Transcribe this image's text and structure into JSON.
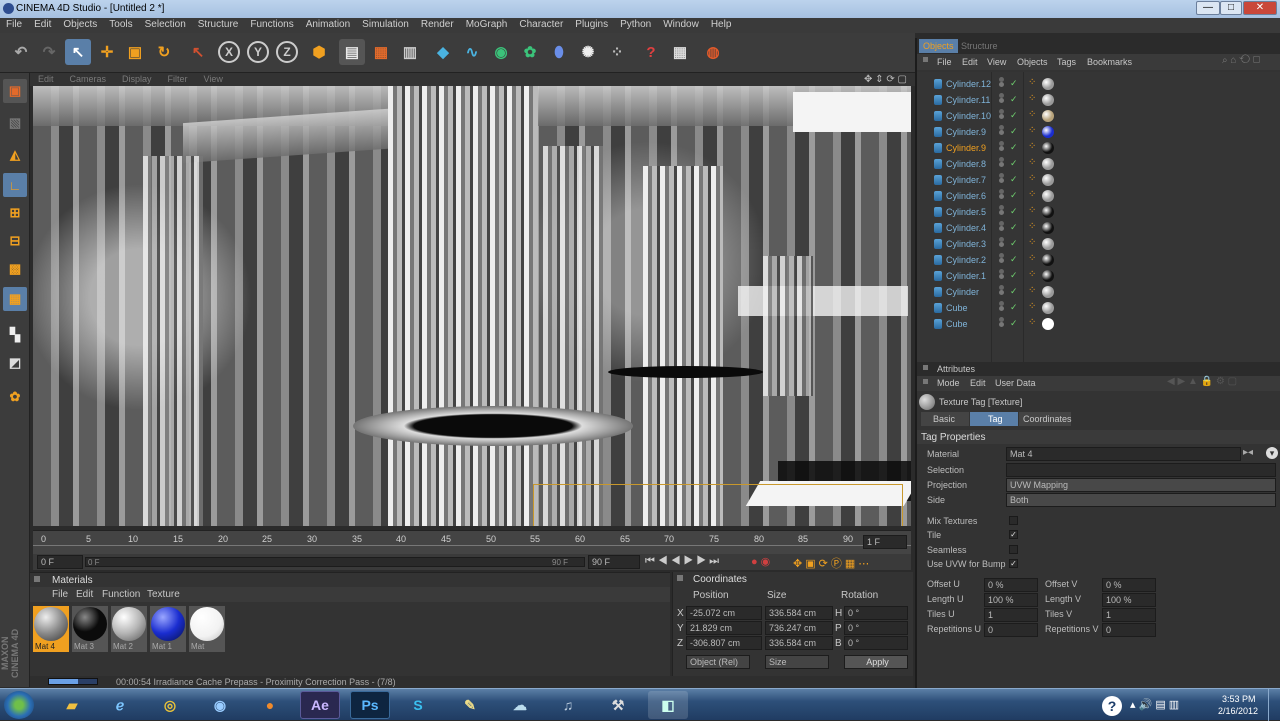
{
  "window": {
    "title": "CINEMA 4D Studio - [Untitled 2 *]",
    "min": "—",
    "max": "□",
    "close": "✕"
  },
  "menu": [
    "File",
    "Edit",
    "Objects",
    "Tools",
    "Selection",
    "Structure",
    "Functions",
    "Animation",
    "Simulation",
    "Render",
    "MoGraph",
    "Character",
    "Plugins",
    "Python",
    "Window",
    "Help"
  ],
  "viewport_menu": [
    "Edit",
    "Cameras",
    "Display",
    "Filter",
    "View"
  ],
  "timeline": {
    "ticks": [
      "0",
      "5",
      "10",
      "15",
      "20",
      "25",
      "30",
      "35",
      "40",
      "45",
      "50",
      "55",
      "60",
      "65",
      "70",
      "75",
      "80",
      "85",
      "90"
    ],
    "end_label": "1 F",
    "start_field": "0 F",
    "current_field": "0 F",
    "max_field": "90 F",
    "end_field": "90 F"
  },
  "materials": {
    "title": "Materials",
    "menu": [
      "File",
      "Edit",
      "Function",
      "Texture"
    ],
    "items": [
      {
        "name": "Mat 4",
        "color": "#8a8a8a"
      },
      {
        "name": "Mat 3",
        "color": "#0b0b0b"
      },
      {
        "name": "Mat 2",
        "color": "#b5b5b5"
      },
      {
        "name": "Mat 1",
        "color": "#1a2dd0"
      },
      {
        "name": "Mat",
        "color": "#ffffff"
      }
    ]
  },
  "coordinates": {
    "title": "Coordinates",
    "headers": [
      "Position",
      "Size",
      "Rotation"
    ],
    "rows": [
      {
        "axis": "X",
        "pos": "-25.072 cm",
        "size": "336.584 cm",
        "rot_axis": "H",
        "rot": "0 °"
      },
      {
        "axis": "Y",
        "pos": "21.829 cm",
        "size": "736.247 cm",
        "rot_axis": "P",
        "rot": "0 °"
      },
      {
        "axis": "Z",
        "pos": "-306.807 cm",
        "size": "336.584 cm",
        "rot_axis": "B",
        "rot": "0 °"
      }
    ],
    "mode": "Object (Rel)",
    "size_mode": "Size",
    "apply": "Apply"
  },
  "status": "00:00:54 Irradiance Cache Prepass - Proximity Correction Pass - (7/8)",
  "branding": "MAXON CINEMA 4D",
  "objects_panel": {
    "tabs": [
      "Objects",
      "Structure"
    ],
    "menu": [
      "File",
      "Edit",
      "View",
      "Objects",
      "Tags",
      "Bookmarks"
    ],
    "rows": [
      {
        "name": "Cylinder.12",
        "mat": "#9a9a9a"
      },
      {
        "name": "Cylinder.11",
        "mat": "#9a9a9a"
      },
      {
        "name": "Cylinder.10",
        "mat": "#b7a27a"
      },
      {
        "name": "Cylinder.9",
        "mat": "#1a2dd0"
      },
      {
        "name": "Cylinder.9",
        "mat": "#111111"
      },
      {
        "name": "Cylinder.8",
        "mat": "#9a9a9a"
      },
      {
        "name": "Cylinder.7",
        "mat": "#9a9a9a"
      },
      {
        "name": "Cylinder.6",
        "mat": "#9a9a9a"
      },
      {
        "name": "Cylinder.5",
        "mat": "#111111"
      },
      {
        "name": "Cylinder.4",
        "mat": "#111111"
      },
      {
        "name": "Cylinder.3",
        "mat": "#9a9a9a"
      },
      {
        "name": "Cylinder.2",
        "mat": "#111111"
      },
      {
        "name": "Cylinder.1",
        "mat": "#111111"
      },
      {
        "name": "Cylinder",
        "mat": "#9a9a9a"
      },
      {
        "name": "Cube",
        "mat": "#9a9a9a"
      },
      {
        "name": "Cube",
        "mat": "#ffffff"
      }
    ]
  },
  "attributes": {
    "title": "Attributes",
    "menu": [
      "Mode",
      "Edit",
      "User Data"
    ],
    "header": "Texture Tag [Texture]",
    "tabs": [
      "Basic",
      "Tag",
      "Coordinates"
    ],
    "section": "Tag Properties",
    "material_label": "Material",
    "material_value": "Mat 4",
    "selection_label": "Selection",
    "projection_label": "Projection",
    "projection_value": "UVW Mapping",
    "side_label": "Side",
    "side_value": "Both",
    "mix_label": "Mix Textures",
    "tile_label": "Tile",
    "seamless_label": "Seamless",
    "uvw_bump_label": "Use UVW for Bump",
    "offset_u_label": "Offset U",
    "offset_u": "0 %",
    "offset_v_label": "Offset V",
    "offset_v": "0 %",
    "length_u_label": "Length U",
    "length_u": "100 %",
    "length_v_label": "Length V",
    "length_v": "100 %",
    "tiles_u_label": "Tiles U",
    "tiles_u": "1",
    "tiles_v_label": "Tiles V",
    "tiles_v": "1",
    "rep_u_label": "Repetitions U",
    "rep_u": "0",
    "rep_v_label": "Repetitions V",
    "rep_v": "0"
  },
  "taskbar": {
    "time": "3:53 PM",
    "date": "2/16/2012",
    "apps": [
      "Explorer",
      "Internet Explorer",
      "Chrome",
      "Media",
      "Firefox",
      "AE",
      "Ps",
      "Skype",
      "Paint",
      "Network",
      "iTunes",
      "Tools",
      "Cinema 4D"
    ]
  }
}
